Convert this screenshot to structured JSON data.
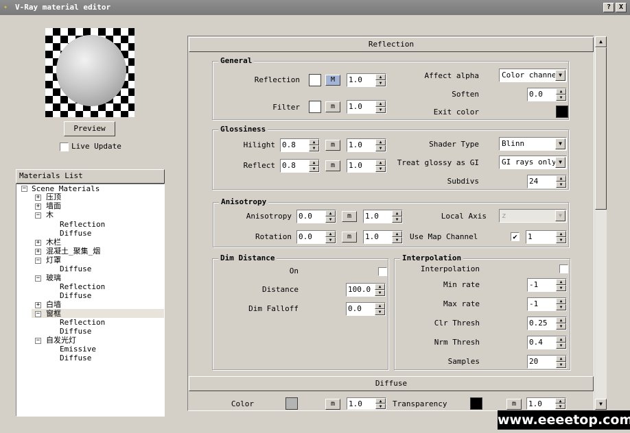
{
  "window": {
    "title": "V-Ray material editor",
    "help": "?",
    "close": "X"
  },
  "preview": {
    "button": "Preview",
    "live_update": "Live Update"
  },
  "materials": {
    "header": "Materials List",
    "root": "Scene Materials",
    "items": [
      "压顶",
      "墙面",
      "木",
      "Reflection",
      "Diffuse",
      "木栏",
      "混凝土_聚集_烟",
      "灯罩",
      "Diffuse",
      "玻璃",
      "Reflection",
      "Diffuse",
      "白墙",
      "窗框",
      "Reflection",
      "Diffuse",
      "自发光灯",
      "Emissive",
      "Diffuse"
    ]
  },
  "reflection": {
    "rollout": "Reflection",
    "general": {
      "title": "General",
      "reflection_label": "Reflection",
      "reflection_map": "M",
      "reflection_value": "1.0",
      "filter_label": "Filter",
      "filter_map": "m",
      "filter_value": "1.0",
      "affect_alpha_label": "Affect alpha",
      "affect_alpha_value": "Color channel",
      "soften_label": "Soften",
      "soften_value": "0.0",
      "exit_color_label": "Exit color"
    },
    "glossiness": {
      "title": "Glossiness",
      "hilight_label": "Hilight",
      "hilight_value": "0.8",
      "hilight_map": "m",
      "hilight_mult": "1.0",
      "reflect_label": "Reflect",
      "reflect_value": "0.8",
      "reflect_map": "m",
      "reflect_mult": "1.0",
      "shader_type_label": "Shader Type",
      "shader_type_value": "Blinn",
      "treat_glossy_label": "Treat glossy as GI",
      "treat_glossy_value": "GI rays only",
      "subdivs_label": "Subdivs",
      "subdivs_value": "24"
    },
    "anisotropy": {
      "title": "Anisotropy",
      "anisotropy_label": "Anisotropy",
      "anisotropy_value": "0.0",
      "anisotropy_map": "m",
      "anisotropy_mult": "1.0",
      "rotation_label": "Rotation",
      "rotation_value": "0.0",
      "rotation_map": "m",
      "rotation_mult": "1.0",
      "local_axis_label": "Local Axis",
      "local_axis_value": "z",
      "use_map_channel_label": "Use Map Channel",
      "use_map_channel_checked": "✔",
      "map_channel_value": "1"
    },
    "dim_distance": {
      "title": "Dim Distance",
      "on_label": "On",
      "distance_label": "Distance",
      "distance_value": "100.0",
      "dim_falloff_label": "Dim Falloff",
      "dim_falloff_value": "0.0"
    },
    "interpolation": {
      "title": "Interpolation",
      "interpolation_label": "Interpolation",
      "min_rate_label": "Min rate",
      "min_rate_value": "-1",
      "max_rate_label": "Max rate",
      "max_rate_value": "-1",
      "clr_thresh_label": "Clr Thresh",
      "clr_thresh_value": "0.25",
      "nrm_thresh_label": "Nrm Thresh",
      "nrm_thresh_value": "0.4",
      "samples_label": "Samples",
      "samples_value": "20"
    }
  },
  "diffuse": {
    "rollout": "Diffuse",
    "color_label": "Color",
    "color_map": "m",
    "color_value": "1.0",
    "transparency_label": "Transparency",
    "transparency_map": "m",
    "transparency_value": "1.0"
  },
  "watermark": "www.eeeetop.com",
  "colors": {
    "reflection_swatch": "#ffffff",
    "filter_swatch": "#ffffff",
    "exit_color": "#000000",
    "diffuse_color": "#b4b4b4",
    "transparency_color": "#000000",
    "selected_row": "#e8e4dc"
  }
}
